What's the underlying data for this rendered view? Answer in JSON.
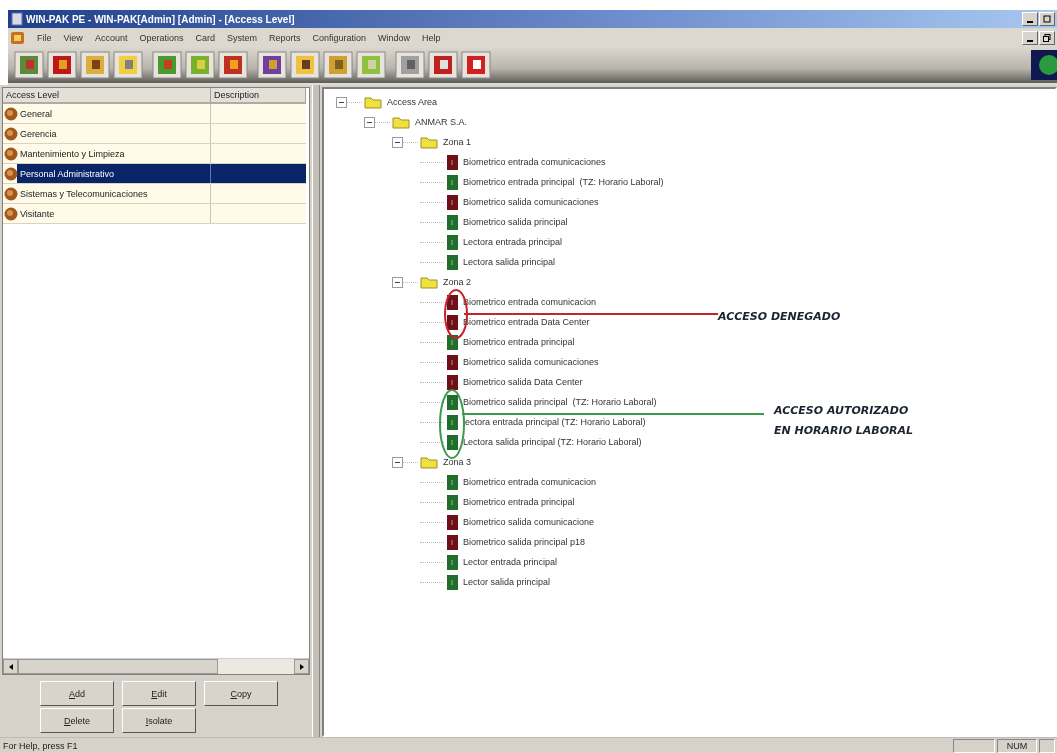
{
  "window": {
    "title": "WIN-PAK PE - WIN-PAK[Admin] [Admin] - [Access Level]"
  },
  "menu": [
    "File",
    "View",
    "Account",
    "Operations",
    "Card",
    "System",
    "Reports",
    "Configuration",
    "Window",
    "Help"
  ],
  "access_levels": {
    "columns": [
      "Access Level",
      "Description"
    ],
    "rows": [
      {
        "name": "General",
        "selected": false
      },
      {
        "name": "Gerencia",
        "selected": false
      },
      {
        "name": "Mantenimiento y Limpieza",
        "selected": false
      },
      {
        "name": "Personal Administrativo",
        "selected": true
      },
      {
        "name": "Sistemas y Telecomunicaciones",
        "selected": false
      },
      {
        "name": "Visitante",
        "selected": false
      }
    ]
  },
  "buttons": [
    [
      "Add",
      "Edit",
      "Copy"
    ],
    [
      "Delete",
      "Isolate"
    ]
  ],
  "tree": [
    {
      "label": "Access Area",
      "expanded": true,
      "children": [
        {
          "label": "ANMAR S.A.",
          "expanded": true,
          "children": [
            {
              "label": "Zona 1",
              "expanded": true,
              "children": [
                {
                  "label": "Biometrico entrada comunicaciones",
                  "granted": false
                },
                {
                  "label": "Biometrico entrada principal  (TZ: Horario Laboral)",
                  "granted": true
                },
                {
                  "label": "Biometrico salida comunicaciones",
                  "granted": false
                },
                {
                  "label": "Biometrico salida principal",
                  "granted": true
                },
                {
                  "label": "Lectora entrada principal",
                  "granted": true
                },
                {
                  "label": "Lectora salida principal",
                  "granted": true
                }
              ]
            },
            {
              "label": "Zona 2",
              "expanded": true,
              "children": [
                {
                  "label": "Biometrico entrada comunicacion",
                  "granted": false
                },
                {
                  "label": "Biometrico entrada Data Center",
                  "granted": false
                },
                {
                  "label": "Biometrico entrada principal",
                  "granted": true
                },
                {
                  "label": "Biometrico salida comunicaciones",
                  "granted": false
                },
                {
                  "label": "Biometrico salida Data Center",
                  "granted": false
                },
                {
                  "label": "Biometrico salida principal  (TZ: Horario Laboral)",
                  "granted": true
                },
                {
                  "label": "lectora entrada principal (TZ: Horario Laboral)",
                  "granted": true
                },
                {
                  "label": "Lectora salida principal (TZ: Horario Laboral)",
                  "granted": true
                }
              ]
            },
            {
              "label": "Zona 3",
              "expanded": true,
              "children": [
                {
                  "label": "Biometrico entrada comunicacion",
                  "granted": true
                },
                {
                  "label": "Biometrico entrada principal",
                  "granted": true
                },
                {
                  "label": "Biometrico salida comunicacione",
                  "granted": false
                },
                {
                  "label": "Biometrico salida principal p18",
                  "granted": false
                },
                {
                  "label": "Lector entrada principal",
                  "granted": true
                },
                {
                  "label": "Lector salida principal",
                  "granted": true
                }
              ]
            }
          ]
        }
      ]
    }
  ],
  "annotations": [
    {
      "kind": "denied",
      "color": "#c4242f",
      "lines": [
        "ACCESO DENEGADO"
      ]
    },
    {
      "kind": "authorized",
      "color": "#3a9a4e",
      "lines": [
        "ACCESO AUTORIZADO",
        "EN HORARIO LABORAL"
      ]
    }
  ],
  "status_bar": {
    "message": "For Help, press F1",
    "indicator": "NUM"
  }
}
